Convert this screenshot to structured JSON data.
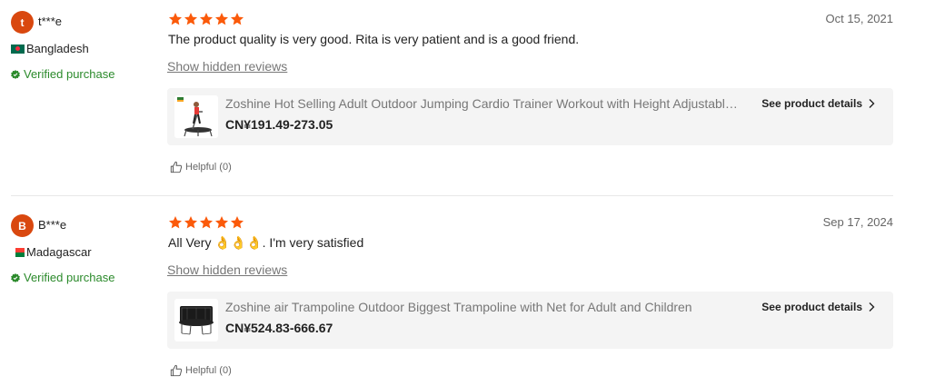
{
  "reviews": [
    {
      "avatar_letter": "t",
      "username": "t***e",
      "country": "Bangladesh",
      "verified_label": "Verified purchase",
      "rating": 5,
      "date": "Oct 15, 2021",
      "text": "The product quality is very good. Rita is very patient and is a good friend.",
      "hidden_reviews_label": "Show hidden reviews",
      "product": {
        "title": "Zoshine Hot Selling Adult Outdoor Jumping Cardio Trainer Workout with Height Adjustable Handrail",
        "price": "CN¥191.49-273.05",
        "details_label": "See product details"
      },
      "helpful_label": "Helpful (0)"
    },
    {
      "avatar_letter": "B",
      "username": "B***e",
      "country": "Madagascar",
      "verified_label": "Verified purchase",
      "rating": 5,
      "date": "Sep 17, 2024",
      "text": "All Very 👌👌👌. I'm very satisfied",
      "hidden_reviews_label": "Show hidden reviews",
      "product": {
        "title": "Zoshine air Trampoline Outdoor Biggest Trampoline with Net for Adult and Children",
        "price": "CN¥524.83-666.67",
        "details_label": "See product details"
      },
      "helpful_label": "Helpful (0)"
    }
  ],
  "colors": {
    "avatar": "#d9480f",
    "star": "#fb5a0a",
    "verified": "#2b8a2b"
  }
}
